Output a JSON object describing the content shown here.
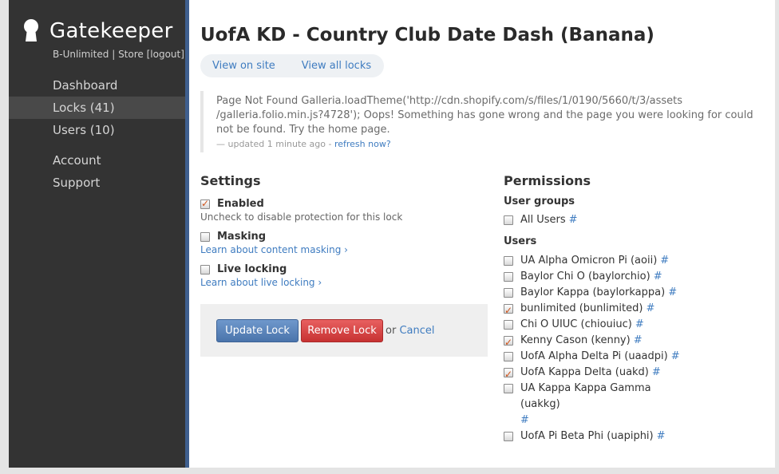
{
  "brand": {
    "name": "Gatekeeper",
    "store_name": "B-Unlimited",
    "store_sep": "|",
    "store_label": "Store",
    "logout": "[logout]"
  },
  "nav": [
    {
      "label": "Dashboard"
    },
    {
      "label": "Locks (41)"
    },
    {
      "label": "Users (10)"
    },
    {
      "label": "Account"
    },
    {
      "label": "Support"
    }
  ],
  "page": {
    "title": "UofA KD - Country Club Date Dash (Banana)",
    "tabs": [
      {
        "label": "View on site"
      },
      {
        "label": "View all locks"
      }
    ]
  },
  "notice": {
    "message": "Page Not Found Galleria.loadTheme('http://cdn.shopify.com/s/files/1/0190/5660/t/3/assets /galleria.folio.min.js?4728'); Oops! Something has gone wrong and the page you were looking for could not be found. Try the home page.",
    "updated": "— updated 1 minute ago -",
    "refresh": "refresh now?"
  },
  "settings": {
    "title": "Settings",
    "enabled": {
      "label": "Enabled",
      "checked": true,
      "help": "Uncheck to disable protection for this lock"
    },
    "masking": {
      "label": "Masking",
      "checked": false,
      "link": "Learn about content masking ›"
    },
    "live": {
      "label": "Live locking",
      "checked": false,
      "link": "Learn about live locking ›"
    },
    "update_label": "Update Lock",
    "remove_label": "Remove Lock",
    "or": "or",
    "cancel": "Cancel"
  },
  "permissions": {
    "title": "Permissions",
    "groups_title": "User groups",
    "all_users": {
      "label": "All Users",
      "checked": false
    },
    "users_title": "Users",
    "hash": "#",
    "users": [
      {
        "label": "UA Alpha Omicron Pi (aoii)",
        "checked": false
      },
      {
        "label": "Baylor Chi O (baylorchio)",
        "checked": false
      },
      {
        "label": "Baylor Kappa (baylorkappa)",
        "checked": false
      },
      {
        "label": "bunlimited (bunlimited)",
        "checked": true
      },
      {
        "label": "Chi O UIUC (chiouiuc)",
        "checked": false
      },
      {
        "label": "Kenny Cason (kenny)",
        "checked": true
      },
      {
        "label": "UofA Alpha Delta Pi (uaadpi)",
        "checked": false
      },
      {
        "label": "UofA Kappa Delta (uakd)",
        "checked": true
      },
      {
        "label": "UA Kappa Kappa Gamma (uakkg)",
        "checked": false
      },
      {
        "label": "UofA Pi Beta Phi (uapiphi)",
        "checked": false
      }
    ]
  },
  "colors": {
    "sidebar": "#333333",
    "accent": "#3f5f8e",
    "link": "#3f7cc0",
    "update_button": "#5a84bb",
    "remove_button": "#d94444"
  }
}
